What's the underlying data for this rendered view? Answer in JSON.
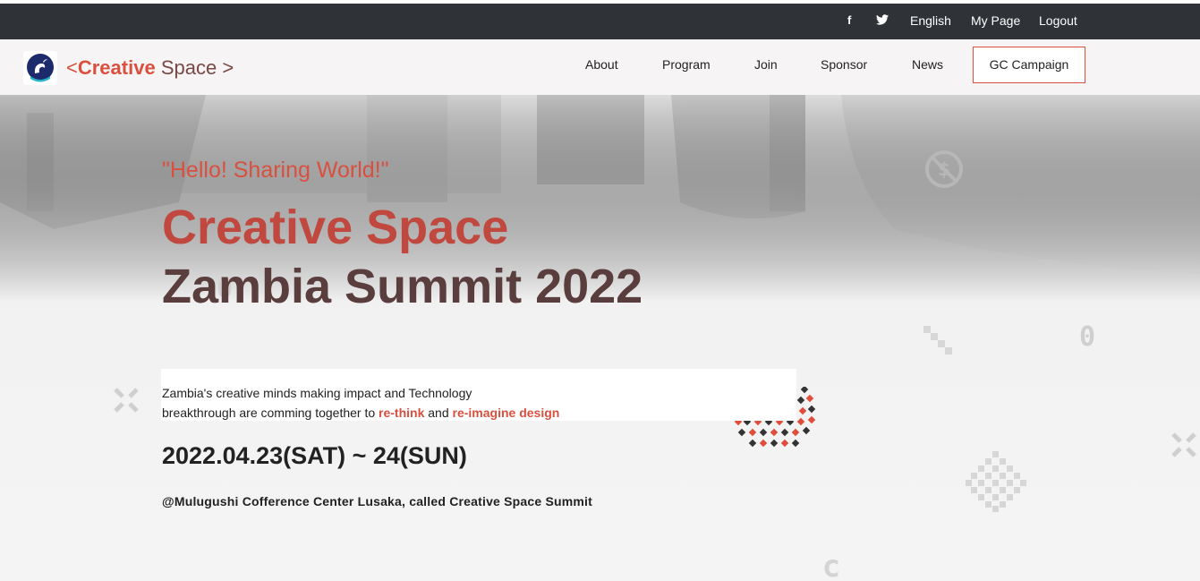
{
  "topbar": {
    "icons": [
      "facebook-icon",
      "twitter-icon"
    ],
    "facebook_glyph": "f",
    "twitter_glyph": "🐦",
    "language": "English",
    "mypage": "My Page",
    "logout": "Logout"
  },
  "brand": {
    "open": "<",
    "bold": "Creative",
    "light": " Space",
    "close": " >"
  },
  "nav": {
    "about": "About",
    "program": "Program",
    "join": "Join",
    "sponsor": "Sponsor",
    "news": "News",
    "campaign": "GC Campaign"
  },
  "hero": {
    "greeting": "\"Hello! Sharing World!\"",
    "title_line1": "Creative Space",
    "title_line2": "Zambia Summit 2022",
    "desc_line1": "Zambia's creative minds making impact and Technology",
    "desc_line2_start": "breakthrough are comming together to ",
    "desc_highlight1": "re-think",
    "desc_mid": " and ",
    "desc_highlight2": "re-imagine design",
    "date": "2022.04.23(SAT) ~ 24(SUN)",
    "venue": "@Mulugushi Cofference Center Lusaka, called Creative Space Summit"
  },
  "colors": {
    "accent": "#d9503f",
    "title_dark": "#5a3d3d",
    "topbar": "#2f3237"
  }
}
